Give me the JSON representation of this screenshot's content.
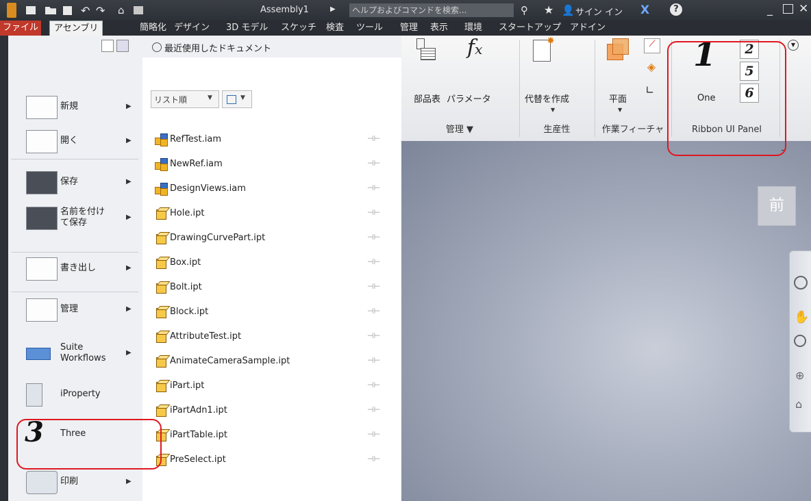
{
  "titlebar": {
    "doc_title": "Assembly1",
    "search_placeholder": "ヘルプおよびコマンドを検索...",
    "signin": "サイン イン"
  },
  "tabs": [
    "ファイル",
    "アセンブリ",
    "簡略化",
    "デザイン",
    "3D モデル",
    "スケッチ",
    "検査",
    "ツール",
    "管理",
    "表示",
    "環境",
    "スタートアップ",
    "アドイン"
  ],
  "ribbon": {
    "bom_label": "部品表",
    "params_label": "パラメータ",
    "manage_footer": "管理 ▼",
    "alt_label": "代替を作成",
    "productivity_footer": "生産性",
    "plane_label": "平面",
    "workfeat_footer": "作業フィーチャ",
    "panel_big_number": "1",
    "panel_big_caption": "One",
    "panel_small_numbers": [
      "2",
      "5",
      "6"
    ],
    "panel_footer": "Ribbon UI Panel"
  },
  "left_menu": [
    {
      "label": "新規",
      "arrow": true
    },
    {
      "label": "開く",
      "arrow": true
    },
    {
      "label": "保存",
      "arrow": true
    },
    {
      "label": "名前を付け\nて保存",
      "arrow": true
    },
    {
      "label": "書き出し",
      "arrow": true
    },
    {
      "label": "管理",
      "arrow": true
    },
    {
      "label": "Suite\nWorkflows",
      "arrow": true
    },
    {
      "label": "iProperty",
      "arrow": false
    },
    {
      "label": "Three",
      "arrow": false
    },
    {
      "label": "印刷",
      "arrow": true
    }
  ],
  "three_item": {
    "number": "3"
  },
  "recent": {
    "header": "最近使用したドキュメント",
    "sort_label": "リスト順",
    "files": [
      {
        "name": "RefTest.iam",
        "type": "iam"
      },
      {
        "name": "NewRef.iam",
        "type": "iam"
      },
      {
        "name": "DesignViews.iam",
        "type": "iam"
      },
      {
        "name": "Hole.ipt",
        "type": "ipt"
      },
      {
        "name": "DrawingCurvePart.ipt",
        "type": "ipt"
      },
      {
        "name": "Box.ipt",
        "type": "ipt"
      },
      {
        "name": "Bolt.ipt",
        "type": "ipt"
      },
      {
        "name": "Block.ipt",
        "type": "ipt"
      },
      {
        "name": "AttributeTest.ipt",
        "type": "ipt"
      },
      {
        "name": "AnimateCameraSample.ipt",
        "type": "ipt"
      },
      {
        "name": "iPart.ipt",
        "type": "ipt"
      },
      {
        "name": "iPartAdn1.ipt",
        "type": "ipt"
      },
      {
        "name": "iPartTable.ipt",
        "type": "ipt"
      },
      {
        "name": "PreSelect.ipt",
        "type": "ipt"
      }
    ]
  },
  "viewcube_label": "前",
  "colors": {
    "accent_red": "#e0171f",
    "file_tab": "#c0392b"
  }
}
